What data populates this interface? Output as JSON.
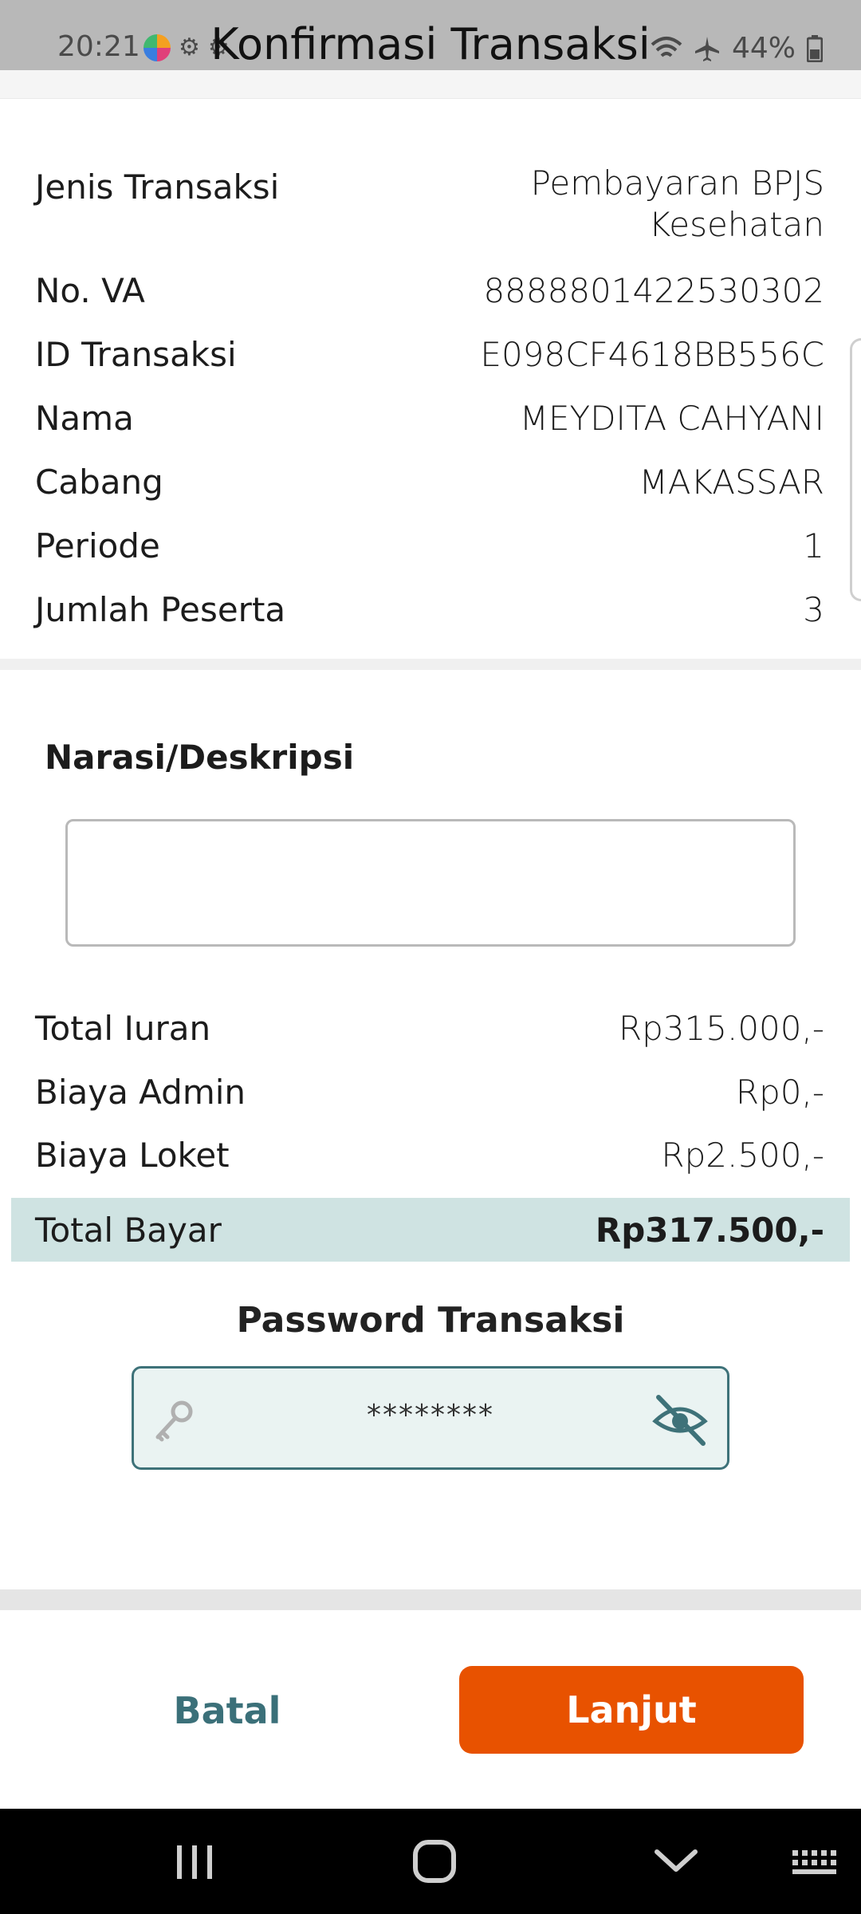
{
  "status_bar": {
    "time": "20:21",
    "battery": "44%"
  },
  "header": {
    "title": "Konfirmasi Transaksi"
  },
  "details": [
    {
      "label": "Jenis Transaksi",
      "value": "Pembayaran BPJS Kesehatan"
    },
    {
      "label": "No. VA",
      "value": "8888801422530302"
    },
    {
      "label": "ID Transaksi",
      "value": "E098CF4618BB556C"
    },
    {
      "label": "Nama",
      "value": "MEYDITA CAHYANI"
    },
    {
      "label": "Cabang",
      "value": "MAKASSAR"
    },
    {
      "label": "Periode",
      "value": "1"
    },
    {
      "label": "Jumlah Peserta",
      "value": "3"
    }
  ],
  "narasi": {
    "label": "Narasi/Deskripsi",
    "value": ""
  },
  "summary": [
    {
      "label": "Total Iuran",
      "value": "Rp315.000,-"
    },
    {
      "label": "Biaya Admin",
      "value": "Rp0,-"
    },
    {
      "label": "Biaya Loket",
      "value": "Rp2.500,-"
    }
  ],
  "total": {
    "label": "Total Bayar",
    "value": "Rp317.500,-"
  },
  "password": {
    "label": "Password Transaksi",
    "value": "********"
  },
  "actions": {
    "cancel_label": "Batal",
    "continue_label": "Lanjut"
  },
  "colors": {
    "accent_orange": "#e85200",
    "teal": "#3b7079",
    "total_band": "#cfe3e2"
  }
}
